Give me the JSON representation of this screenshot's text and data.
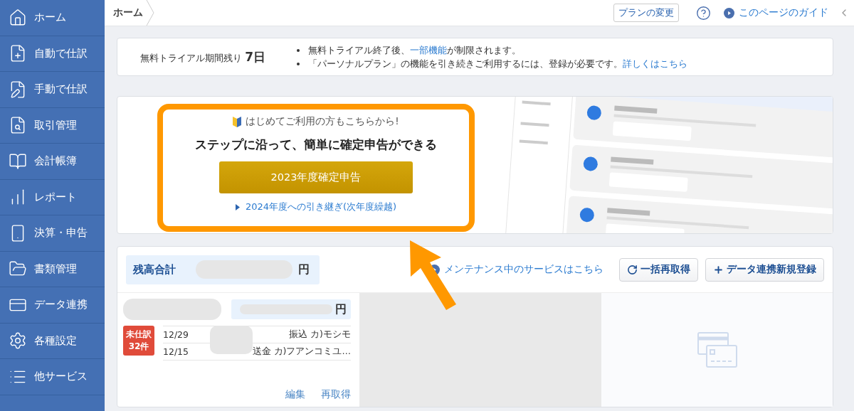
{
  "sidebar": {
    "items": [
      {
        "label": "ホーム"
      },
      {
        "label": "自動で仕訳"
      },
      {
        "label": "手動で仕訳"
      },
      {
        "label": "取引管理"
      },
      {
        "label": "会計帳簿"
      },
      {
        "label": "レポート"
      },
      {
        "label": "決算・申告"
      },
      {
        "label": "書類管理"
      },
      {
        "label": "データ連携"
      },
      {
        "label": "各種設定"
      },
      {
        "label": "他サービス"
      }
    ]
  },
  "breadcrumb": "ホーム",
  "header": {
    "plan_button": "プランの変更",
    "guide_link": "このページのガイド"
  },
  "trial": {
    "label": "無料トライアル期間残り",
    "days": "7日",
    "notes": [
      {
        "before": "無料トライアル終了後、",
        "link": "一部機能",
        "after": "が制限されます。"
      },
      {
        "before": "「パーソナルプラン」の機能を引き続きご利用するには、登録が必要です。",
        "link": "詳しくはこちら"
      }
    ]
  },
  "banner": {
    "hint": "はじめてご利用の方もこちらから!",
    "headline": "ステップに沿って、簡単に確定申告ができる",
    "button": "2023年度確定申告",
    "link": "2024年度への引き継ぎ(次年度繰越)"
  },
  "accounts": {
    "total_label": "残高合計",
    "total_unit": "円",
    "maintenance_link": "メンテナンス中のサービスはこちら",
    "refetch_all_button": "一括再取得",
    "add_button": "データ連携新規登録",
    "account": {
      "unit": "円",
      "badge": "未仕訳 32件",
      "transactions": [
        {
          "date": "12/29",
          "description": "振込 カ)モシモ"
        },
        {
          "date": "12/15",
          "description": "送金 カ)フアンコミユ…"
        }
      ],
      "actions": [
        "編集",
        "再取得"
      ]
    }
  }
}
